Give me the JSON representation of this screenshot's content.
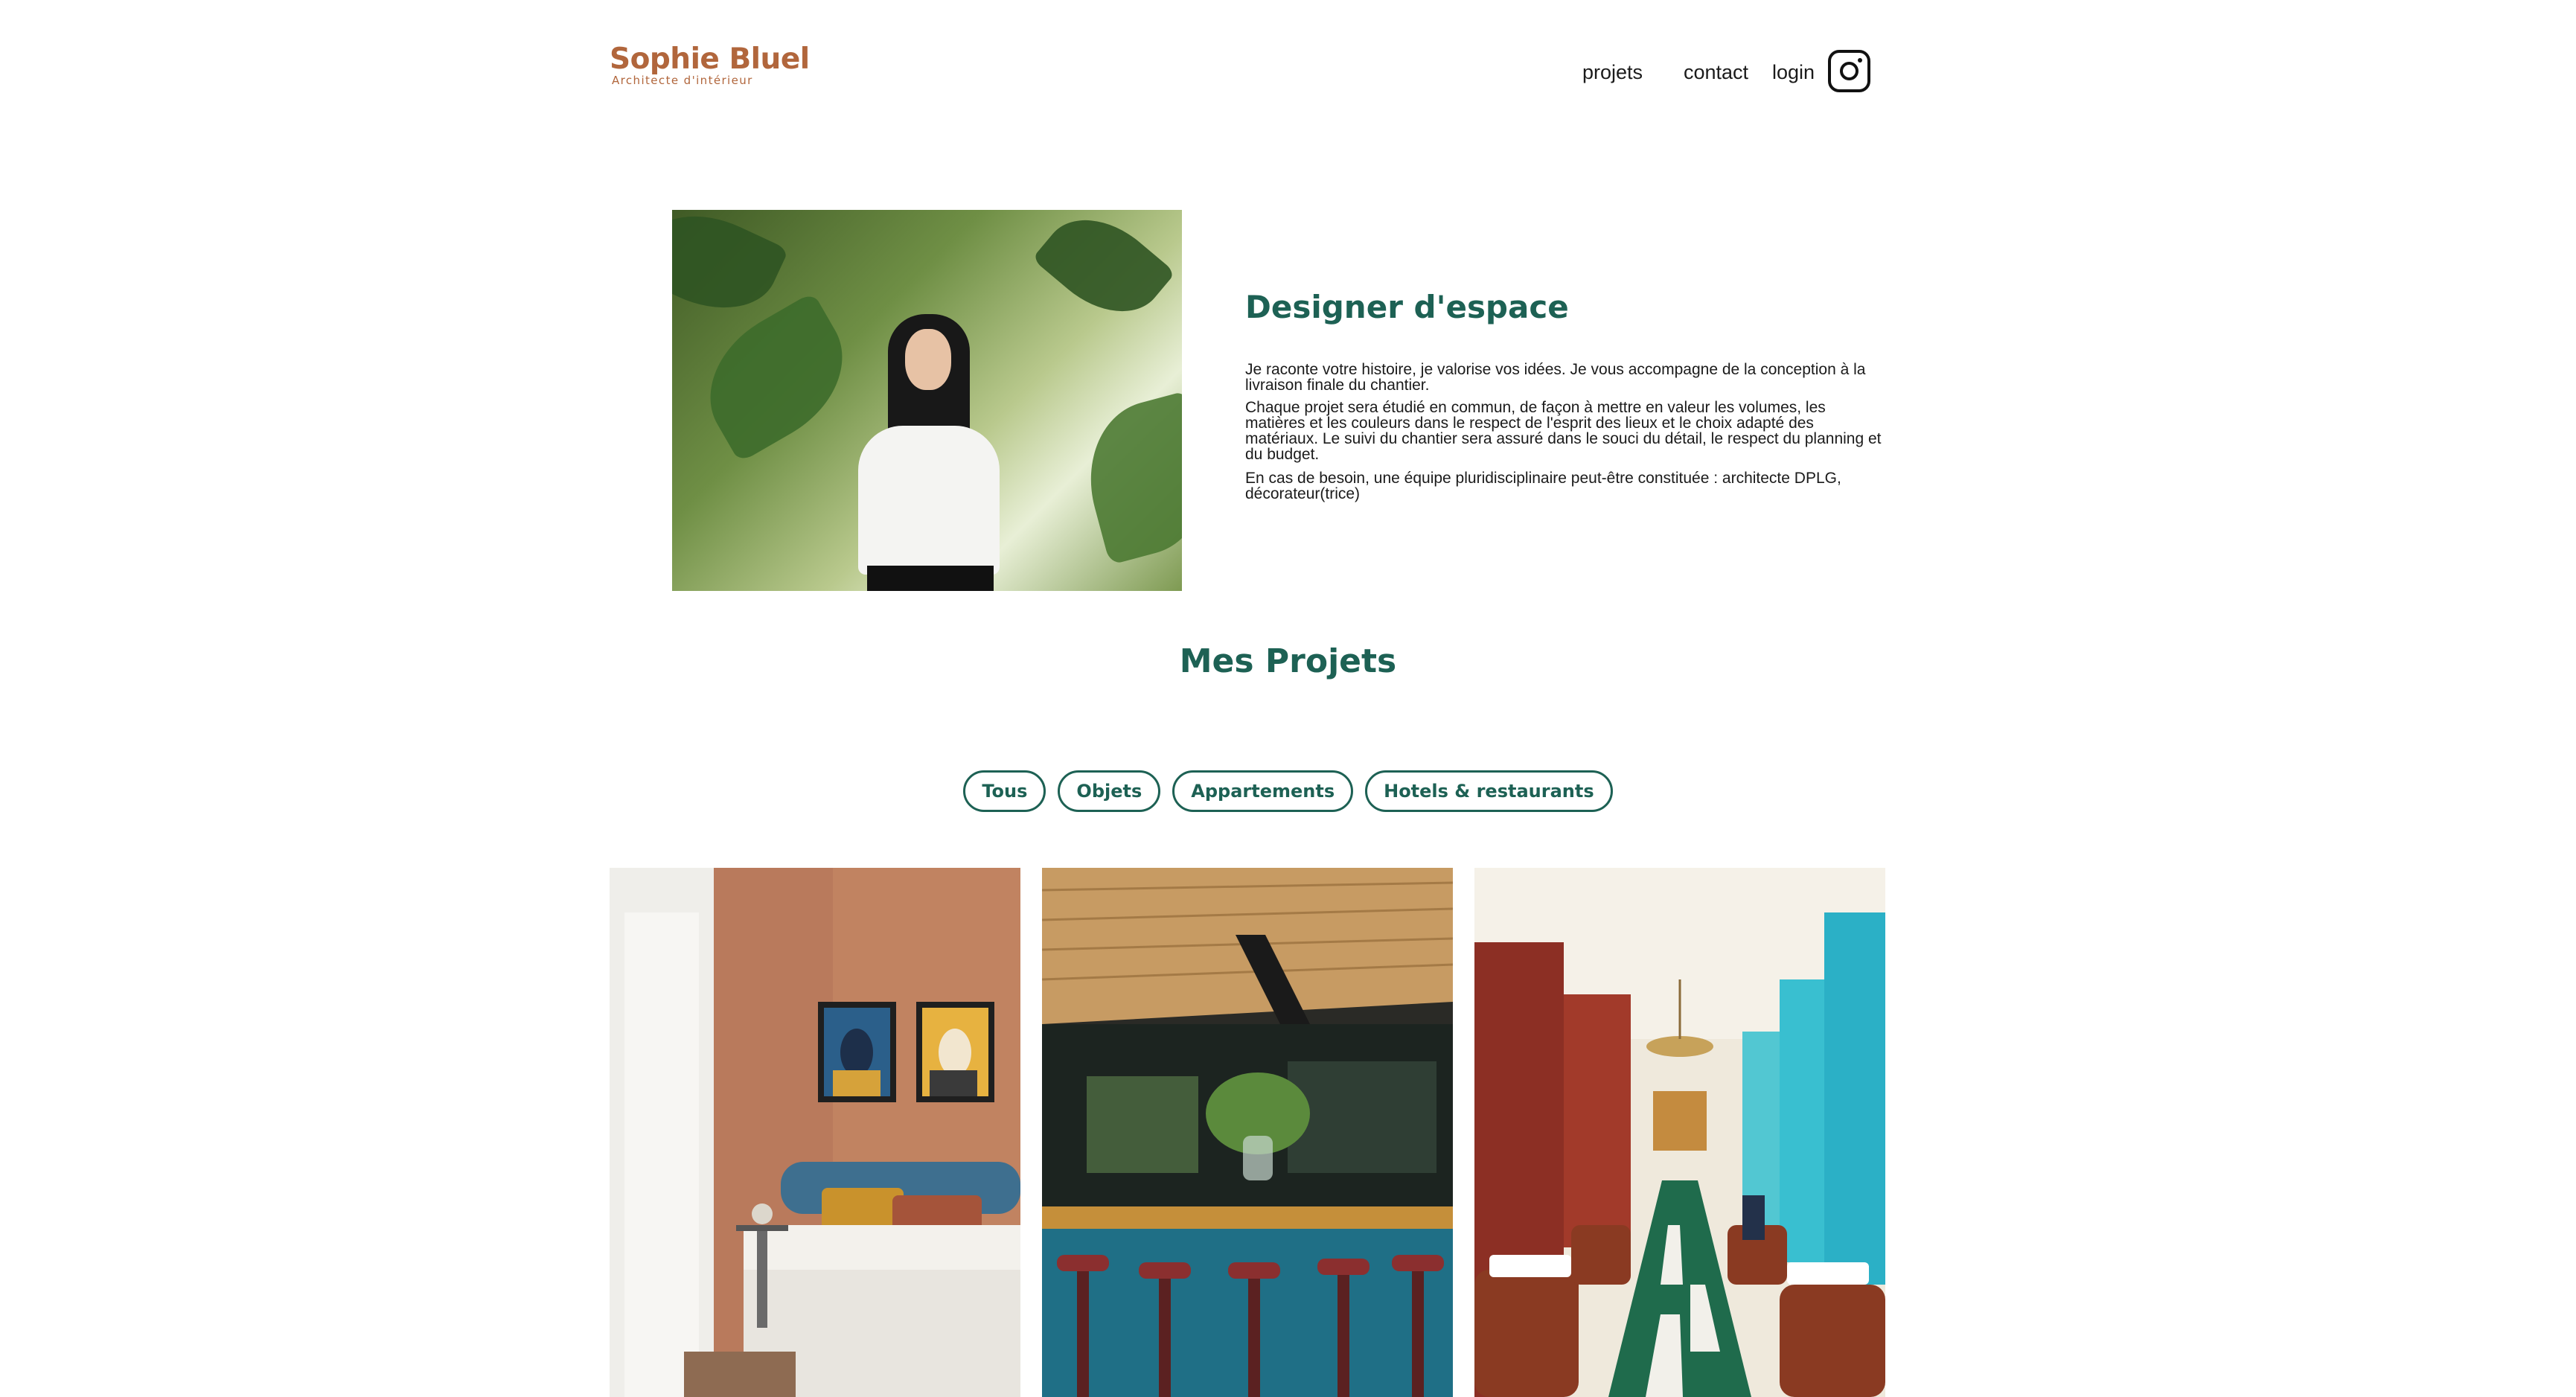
{
  "header": {
    "logo_title": "Sophie Bluel",
    "logo_subtitle": "Architecte d'intérieur",
    "nav": [
      "projets",
      "contact",
      "login"
    ],
    "instagram_icon": "instagram-icon"
  },
  "introduction": {
    "title": "Designer d'espace",
    "paragraphs": [
      "Je raconte votre histoire, je valorise vos idées. Je vous accompagne de la conception à la livraison finale du chantier.",
      "Chaque projet sera étudié en commun, de façon à mettre en valeur les volumes, les matières et les couleurs dans le respect de l'esprit des lieux et le choix adapté des matériaux. Le suivi du chantier sera assuré dans le souci du détail, le respect du planning et du budget.",
      "En cas de besoin, une équipe pluridisciplinaire peut-être constituée : architecte DPLG, décorateur(trice)"
    ]
  },
  "portfolio": {
    "title": "Mes Projets",
    "filters": [
      "Tous",
      "Objets",
      "Appartements",
      "Hotels & restaurants"
    ]
  },
  "colors": {
    "brand": "#B1663C",
    "accent": "#1D6154"
  }
}
